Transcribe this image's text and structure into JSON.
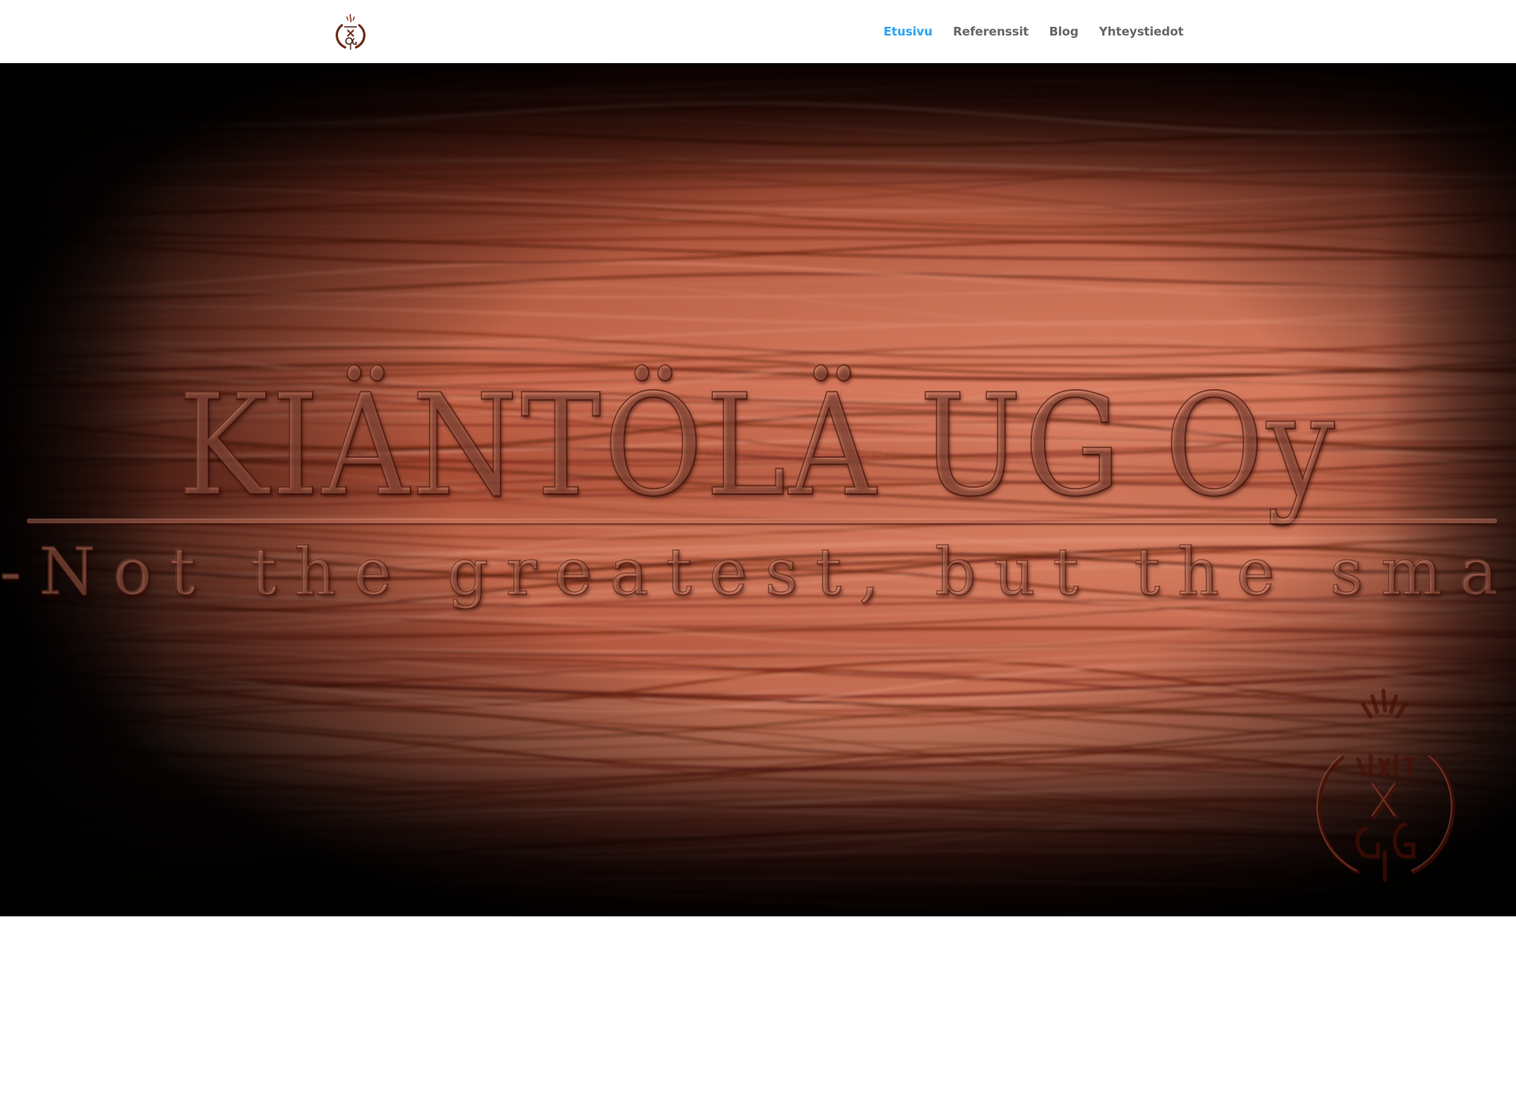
{
  "header": {
    "logo": {
      "icon": "kiantola-ug-logo-icon"
    },
    "nav": [
      {
        "label": "Etusivu",
        "active": true
      },
      {
        "label": "Referenssit",
        "active": false
      },
      {
        "label": "Blog",
        "active": false
      },
      {
        "label": "Yhteystiedot",
        "active": false
      }
    ],
    "colors": {
      "nav_active": "#2ea3f2",
      "nav_default": "#666666"
    }
  },
  "hero": {
    "title": "KIÄNTÖLÄ UG Oy",
    "tagline": "-Not the greatest, but the smartest-",
    "emblem": {
      "icon": "kiantola-ug-emblem-icon"
    },
    "background": "wood-texture"
  }
}
